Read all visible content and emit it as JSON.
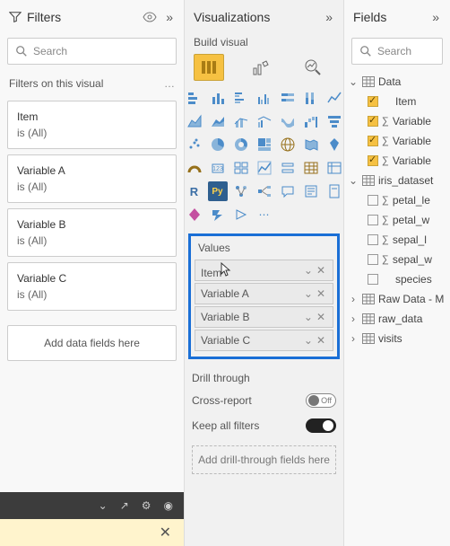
{
  "filters": {
    "title": "Filters",
    "search_placeholder": "Search",
    "section_label": "Filters on this visual",
    "cards": [
      {
        "name": "Item",
        "value": "is (All)"
      },
      {
        "name": "Variable A",
        "value": "is (All)"
      },
      {
        "name": "Variable B",
        "value": "is (All)"
      },
      {
        "name": "Variable C",
        "value": "is (All)"
      }
    ],
    "add_label": "Add data fields here"
  },
  "viz": {
    "title": "Visualizations",
    "build_label": "Build visual",
    "values_label": "Values",
    "values": [
      {
        "name": "Item"
      },
      {
        "name": "Variable A"
      },
      {
        "name": "Variable B"
      },
      {
        "name": "Variable C"
      }
    ],
    "drill_label": "Drill through",
    "cross_report_label": "Cross-report",
    "cross_report_state": "Off",
    "keep_filters_label": "Keep all filters",
    "keep_filters_state": "On",
    "add_drill_label": "Add drill-through fields here"
  },
  "fields": {
    "title": "Fields",
    "search_placeholder": "Search",
    "tables": [
      {
        "name": "Data",
        "expanded": true,
        "columns": [
          {
            "name": "Item",
            "checked": true,
            "agg": false
          },
          {
            "name": "Variable",
            "checked": true,
            "agg": true
          },
          {
            "name": "Variable",
            "checked": true,
            "agg": true
          },
          {
            "name": "Variable",
            "checked": true,
            "agg": true
          }
        ]
      },
      {
        "name": "iris_dataset",
        "expanded": true,
        "columns": [
          {
            "name": "petal_le",
            "checked": false,
            "agg": true
          },
          {
            "name": "petal_w",
            "checked": false,
            "agg": true
          },
          {
            "name": "sepal_l",
            "checked": false,
            "agg": true
          },
          {
            "name": "sepal_w",
            "checked": false,
            "agg": true
          },
          {
            "name": "species",
            "checked": false,
            "agg": false
          }
        ]
      },
      {
        "name": "Raw Data - M",
        "expanded": false,
        "columns": []
      },
      {
        "name": "raw_data",
        "expanded": false,
        "columns": []
      },
      {
        "name": "visits",
        "expanded": false,
        "columns": []
      }
    ]
  }
}
